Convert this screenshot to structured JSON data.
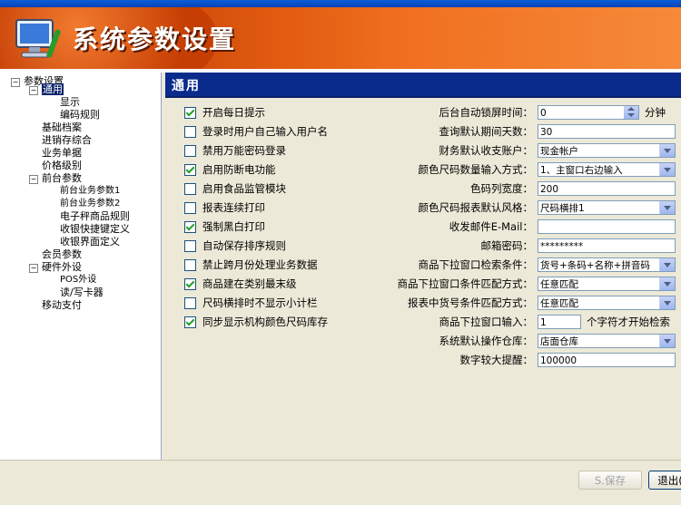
{
  "banner": {
    "title": "系统参数设置"
  },
  "sidebar": {
    "items": [
      {
        "label": "参数设置"
      },
      {
        "label": "通用"
      },
      {
        "label": "显示"
      },
      {
        "label": "编码规则"
      },
      {
        "label": "基础档案"
      },
      {
        "label": "进销存综合"
      },
      {
        "label": "业务单据"
      },
      {
        "label": "价格级别"
      },
      {
        "label": "前台参数"
      },
      {
        "label": "前台业务参数1"
      },
      {
        "label": "前台业务参数2"
      },
      {
        "label": "电子秤商品规则"
      },
      {
        "label": "收银快捷键定义"
      },
      {
        "label": "收银界面定义"
      },
      {
        "label": "会员参数"
      },
      {
        "label": "硬件外设"
      },
      {
        "label": "POS外设"
      },
      {
        "label": "读/写卡器"
      },
      {
        "label": "移动支付"
      }
    ]
  },
  "panel": {
    "title": "通用"
  },
  "checkboxes": [
    {
      "label": "开启每日提示",
      "checked": true
    },
    {
      "label": "登录时用户自己输入用户名",
      "checked": false
    },
    {
      "label": "禁用万能密码登录",
      "checked": false
    },
    {
      "label": "启用防断电功能",
      "checked": true
    },
    {
      "label": "启用食品监管模块",
      "checked": false
    },
    {
      "label": "报表连续打印",
      "checked": false
    },
    {
      "label": "强制黑白打印",
      "checked": true
    },
    {
      "label": "自动保存排序规则",
      "checked": false
    },
    {
      "label": "禁止跨月份处理业务数据",
      "checked": false
    },
    {
      "label": "商品建在类别最末级",
      "checked": true
    },
    {
      "label": "尺码横排时不显示小计栏",
      "checked": false
    },
    {
      "label": "同步显示机构颜色尺码库存",
      "checked": true
    }
  ],
  "fields": [
    {
      "label": "后台自动锁屏时间：",
      "value": "0",
      "suffix": "分钟"
    },
    {
      "label": "查询默认期间天数：",
      "value": "30"
    },
    {
      "label": "财务默认收支账户：",
      "value": "现金帐户"
    },
    {
      "label": "颜色尺码数量输入方式：",
      "value": "1、主窗口右边输入"
    },
    {
      "label": "色码列宽度：",
      "value": "200"
    },
    {
      "label": "颜色尺码报表默认风格：",
      "value": "尺码横排1"
    },
    {
      "label": "收发邮件E-Mail：",
      "value": ""
    },
    {
      "label": "邮箱密码：",
      "value": "*********"
    },
    {
      "label": "商品下拉窗口检索条件：",
      "value": "货号+条码+名称+拼音码"
    },
    {
      "label": "商品下拉窗口条件匹配方式：",
      "value": "任意匹配"
    },
    {
      "label": "报表中货号条件匹配方式：",
      "value": "任意匹配"
    },
    {
      "label": "商品下拉窗口输入：",
      "value": "1",
      "suffix": "个字符才开始检索"
    },
    {
      "label": "系统默认操作仓库：",
      "value": "店面仓库"
    },
    {
      "label": "数字较大提醒：",
      "value": "100000"
    }
  ],
  "footer": {
    "save_label": "S.保存",
    "exit_label": "退出("
  }
}
